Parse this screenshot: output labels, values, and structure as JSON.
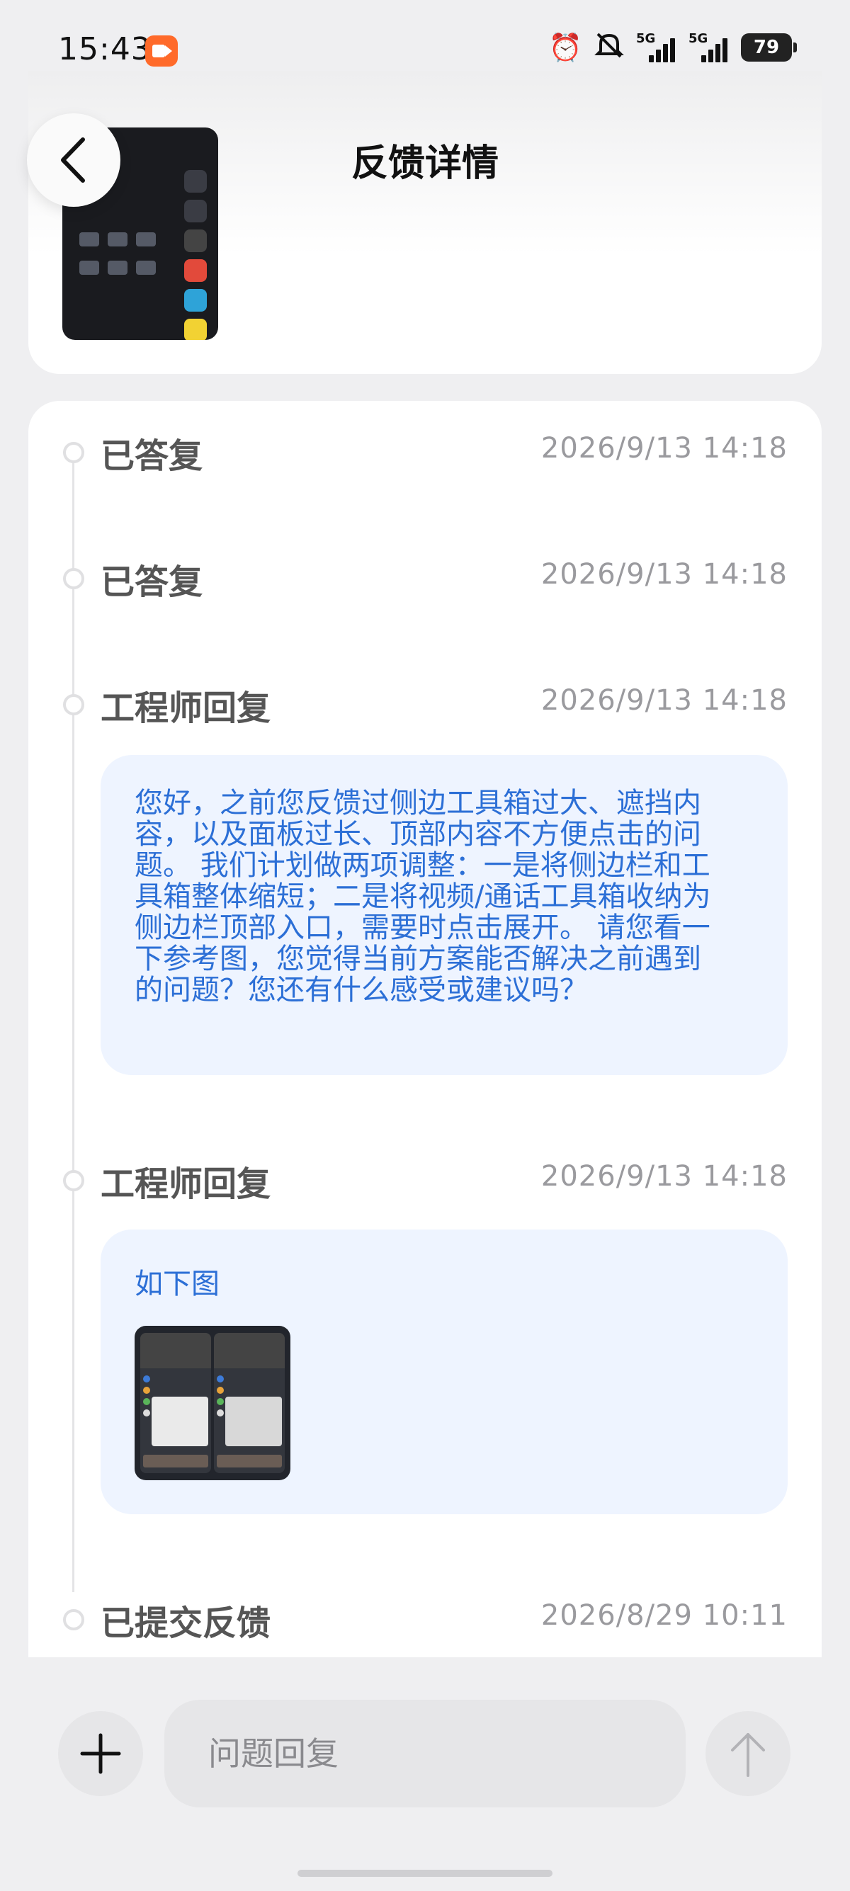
{
  "status_bar": {
    "time": "15:43",
    "network1": "5G",
    "network2": "5G",
    "battery": "79",
    "icons": [
      "screen-record-icon",
      "alarm-icon",
      "mute-bell-icon",
      "signal-icon",
      "battery-icon"
    ]
  },
  "header": {
    "title": "反馈详情"
  },
  "timeline": [
    {
      "status": "已答复",
      "time": "2026/9/13 14:18"
    },
    {
      "status": "已答复",
      "time": "2026/9/13 14:18"
    },
    {
      "status": "工程师回复",
      "time": "2026/9/13 14:18",
      "message": "您好，之前您反馈过侧边工具箱过大、遮挡内容，以及面板过长、顶部内容不方便点击的问题。 我们计划做两项调整：一是将侧边栏和工具箱整体缩短；二是将视频/通话工具箱收纳为侧边栏顶部入口，需要时点击展开。 请您看一下参考图，您觉得当前方案能否解决之前遇到的问题？您还有什么感受或建议吗？"
    },
    {
      "status": "工程师回复",
      "time": "2026/9/13 14:18",
      "message": "如下图"
    },
    {
      "status": "已提交反馈",
      "time": "2026/8/29 10:11"
    }
  ],
  "composer": {
    "placeholder": "问题回复"
  },
  "colors": {
    "accent_text": "#2c6fd6",
    "bubble_bg": "#eef4ff",
    "page_bg": "#efeff1"
  }
}
